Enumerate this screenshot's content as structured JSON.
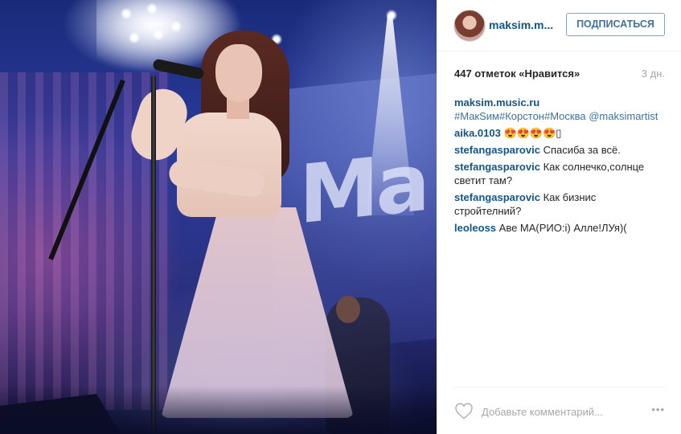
{
  "header": {
    "username": "maksim.m...",
    "follow_label": "ПОДПИСАТЬСЯ"
  },
  "post": {
    "likes": "447 отметок «Нравится»",
    "time": "3 дн.",
    "banner_text": "Ma"
  },
  "comments": [
    {
      "author": "maksim.music.ru",
      "text": "#МакSим#Корстон#Москва",
      "link": "@maksimartist"
    },
    {
      "author": "aika.0103",
      "text": "😍😍😍😍▯"
    },
    {
      "author": "stefangasparovic",
      "text": "Спасиба за всё."
    },
    {
      "author": "stefangasparovic",
      "text": "Как солнечко,солнце светит там?"
    },
    {
      "author": "stefangasparovic",
      "text": "Как бизнис стройтелний?"
    },
    {
      "author": "leoleoss",
      "text": "Аве МА(РИО:і) Алле!ЛУя)("
    }
  ],
  "footer": {
    "comment_placeholder": "Добавьте комментарий...",
    "more_label": "•••"
  },
  "colors": {
    "username": "#125688",
    "follow_border": "#70a6d8",
    "muted": "#a5a7aa"
  }
}
